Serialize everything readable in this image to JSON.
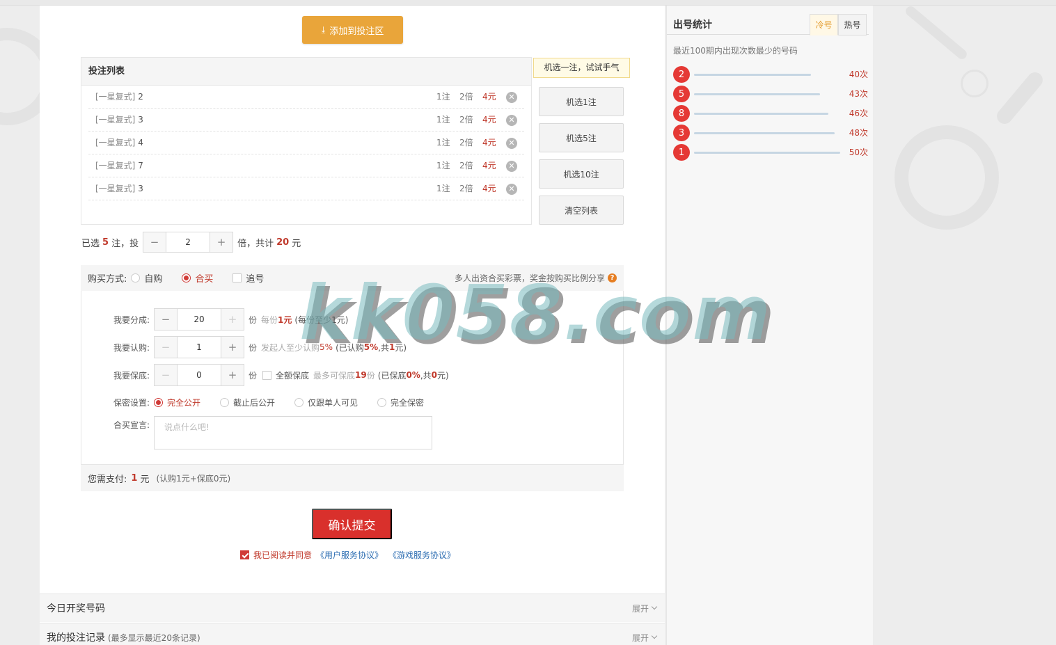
{
  "buttons": {
    "add_to_bet_area": "添加到投注区",
    "submit": "确认提交"
  },
  "bet_list": {
    "title": "投注列表",
    "rows": [
      {
        "tag": "[一星复式]",
        "num": "2",
        "zhu": "1注",
        "bei": "2倍",
        "yuan": "4元"
      },
      {
        "tag": "[一星复式]",
        "num": "3",
        "zhu": "1注",
        "bei": "2倍",
        "yuan": "4元"
      },
      {
        "tag": "[一星复式]",
        "num": "4",
        "zhu": "1注",
        "bei": "2倍",
        "yuan": "4元"
      },
      {
        "tag": "[一星复式]",
        "num": "7",
        "zhu": "1注",
        "bei": "2倍",
        "yuan": "4元"
      },
      {
        "tag": "[一星复式]",
        "num": "3",
        "zhu": "1注",
        "bei": "2倍",
        "yuan": "4元"
      }
    ]
  },
  "random": {
    "tip": "机选一注，试试手气",
    "btn1": "机选1注",
    "btn5": "机选5注",
    "btn10": "机选10注",
    "clear": "清空列表"
  },
  "summary": {
    "pre": "已选",
    "count": "5",
    "mid": "注，投",
    "multiple": "2",
    "post": "倍，共计",
    "total": "20",
    "unit": "元",
    "minus": "−",
    "plus": "+"
  },
  "buy_mode": {
    "label": "购买方式:",
    "options": [
      "自购",
      "合买",
      "追号"
    ],
    "selected": "合买",
    "hint": "多人出资合买彩票，奖金按购买比例分享",
    "hint_icon": "?"
  },
  "hemai": {
    "shares_label": "我要分成:",
    "shares_value": "20",
    "shares_unit": "份",
    "shares_note_a": "每份",
    "shares_note_b": "1元",
    "shares_note_c": "(每份至少1元)",
    "buy_label": "我要认购:",
    "buy_value": "1",
    "buy_unit": "份",
    "buy_note_a": "发起人至少认购",
    "buy_note_b": "5%",
    "buy_note_c": "(已认购",
    "buy_note_d": "5%",
    "buy_note_e": ",共",
    "buy_note_f": "1",
    "buy_note_g": "元)",
    "guarantee_label": "我要保底:",
    "guarantee_value": "0",
    "guarantee_unit": "份",
    "full_guarantee": "全额保底",
    "guarantee_note_a": "最多可保底",
    "guarantee_note_b": "19",
    "guarantee_note_c": "份",
    "guarantee_note_d": "(已保底",
    "guarantee_note_e": "0%",
    "guarantee_note_f": ",共",
    "guarantee_note_g": "0",
    "guarantee_note_h": "元)",
    "privacy_label": "保密设置:",
    "privacy_options": [
      "完全公开",
      "截止后公开",
      "仅跟单人可见",
      "完全保密"
    ],
    "privacy_selected": "完全公开",
    "declare_label": "合买宣言:",
    "declare_placeholder": "说点什么吧!"
  },
  "pay": {
    "label": "您需支付:",
    "amount": "1",
    "unit": "元",
    "note": "(认购1元+保底0元)"
  },
  "agreement": {
    "text": "我已阅读并同意",
    "link1": "《用户服务协议》",
    "link2": "《游戏服务协议》"
  },
  "sections": {
    "today": "今日开奖号码",
    "records": "我的投注记录",
    "records_sub": "(最多显示最近20条记录)",
    "expand": "展开"
  },
  "stats": {
    "title": "出号统计",
    "tab_cold": "冷号",
    "tab_hot": "热号",
    "active_tab": "冷号",
    "desc": "最近100期内出现次数最少的号码",
    "rows": [
      {
        "num": "2",
        "count": "40次",
        "value": 40
      },
      {
        "num": "5",
        "count": "43次",
        "value": 43
      },
      {
        "num": "8",
        "count": "46次",
        "value": 46
      },
      {
        "num": "3",
        "count": "48次",
        "value": 48
      },
      {
        "num": "1",
        "count": "50次",
        "value": 50
      }
    ]
  },
  "watermark": "kk058.com",
  "colors": {
    "accent_red": "#d9302c",
    "button_orange": "#e9a53a",
    "link_blue": "#2f6fb3",
    "ball_red": "#e53935"
  }
}
